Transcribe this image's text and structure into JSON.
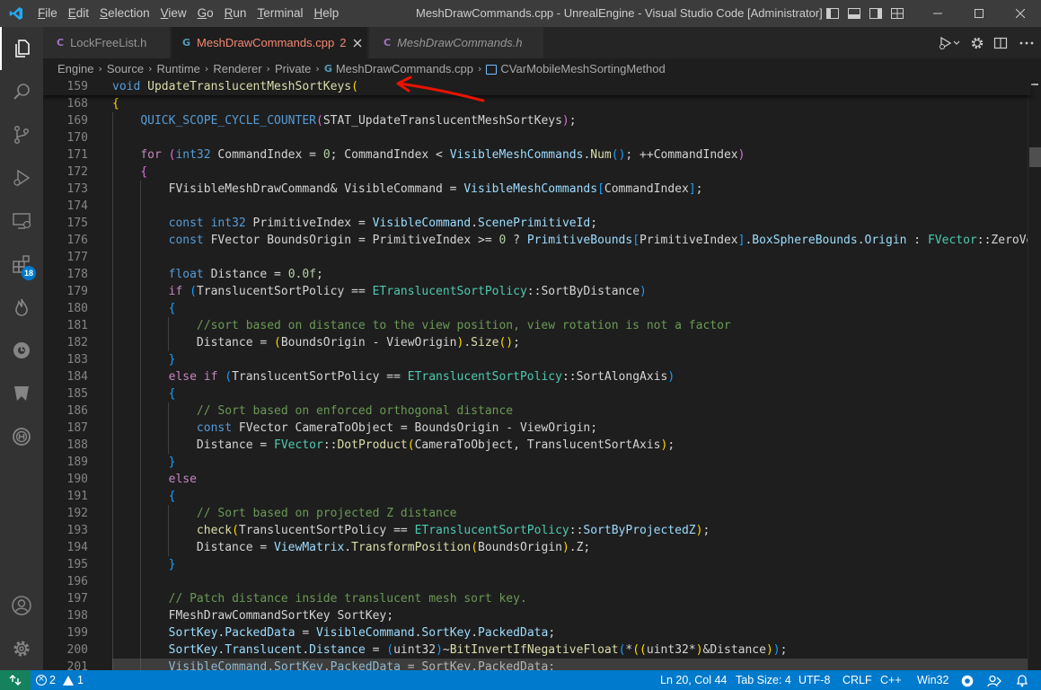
{
  "window": {
    "title": "MeshDrawCommands.cpp - UnrealEngine - Visual Studio Code [Administrator]",
    "menu": [
      "File",
      "Edit",
      "Selection",
      "View",
      "Go",
      "Run",
      "Terminal",
      "Help"
    ]
  },
  "tabs": [
    {
      "label": "LockFreeList.h",
      "icon": "C",
      "icon_color": "#a074c4",
      "color": "#969696",
      "italic": false
    },
    {
      "label": "MeshDrawCommands.cpp",
      "badge": "2",
      "icon": "G",
      "icon_color": "#519aba",
      "color": "#f48771",
      "italic": false
    },
    {
      "label": "MeshDrawCommands.h",
      "icon": "C",
      "icon_color": "#a074c4",
      "color": "#969696",
      "italic": true
    }
  ],
  "breadcrumbs": [
    "Engine",
    "Source",
    "Runtime",
    "Renderer",
    "Private",
    "MeshDrawCommands.cpp",
    "CVarMobileMeshSortingMethod"
  ],
  "activity_badge": "18",
  "status": {
    "errors": "2",
    "warnings": "1",
    "position": "Ln 20, Col 44",
    "tab_size": "Tab Size: 4",
    "encoding": "UTF-8",
    "eol": "CRLF",
    "language": "C++",
    "platform": "Win32"
  },
  "colors": {
    "accent": "#007acc",
    "remote": "#16825d",
    "error_tab": "#f48771",
    "arrow": "#e51400"
  },
  "editor": {
    "lines": [
      {
        "n": "159",
        "sticky": true,
        "tokens": [
          [
            "void ",
            "k"
          ],
          [
            "UpdateTranslucentMeshSortKeys",
            "f"
          ],
          [
            "(",
            "br1"
          ]
        ]
      },
      {
        "n": "168",
        "tokens": [
          [
            "{",
            "br1"
          ]
        ]
      },
      {
        "n": "169",
        "tokens": [
          [
            "    ",
            "p"
          ],
          [
            "QUICK_SCOPE_CYCLE_COUNTER",
            "mac"
          ],
          [
            "(",
            "br2"
          ],
          [
            "STAT_UpdateTranslucentMeshSortKeys",
            "p"
          ],
          [
            ")",
            "br2"
          ],
          [
            ";",
            "p"
          ]
        ]
      },
      {
        "n": "170",
        "tokens": []
      },
      {
        "n": "171",
        "tokens": [
          [
            "    ",
            "p"
          ],
          [
            "for",
            "c"
          ],
          [
            " ",
            "p"
          ],
          [
            "(",
            "br2"
          ],
          [
            "int32",
            "k"
          ],
          [
            " CommandIndex = ",
            "p"
          ],
          [
            "0",
            "n"
          ],
          [
            "; CommandIndex < ",
            "p"
          ],
          [
            "VisibleMeshCommands",
            "v"
          ],
          [
            ".",
            "p"
          ],
          [
            "Num",
            "f"
          ],
          [
            "()",
            "br3"
          ],
          [
            "; ++CommandIndex",
            "p"
          ],
          [
            ")",
            "br2"
          ]
        ]
      },
      {
        "n": "172",
        "tokens": [
          [
            "    ",
            "p"
          ],
          [
            "{",
            "br2"
          ]
        ]
      },
      {
        "n": "173",
        "tokens": [
          [
            "        FVisibleMeshDrawCommand& VisibleCommand = ",
            "p"
          ],
          [
            "VisibleMeshCommands",
            "v"
          ],
          [
            "[",
            "br3"
          ],
          [
            "CommandIndex",
            "p"
          ],
          [
            "]",
            "br3"
          ],
          [
            ";",
            "p"
          ]
        ]
      },
      {
        "n": "174",
        "tokens": []
      },
      {
        "n": "175",
        "tokens": [
          [
            "        ",
            "p"
          ],
          [
            "const",
            "k"
          ],
          [
            " ",
            "p"
          ],
          [
            "int32",
            "k"
          ],
          [
            " PrimitiveIndex = ",
            "p"
          ],
          [
            "VisibleCommand",
            "v"
          ],
          [
            ".",
            "p"
          ],
          [
            "ScenePrimitiveId",
            "v"
          ],
          [
            ";",
            "p"
          ]
        ]
      },
      {
        "n": "176",
        "tokens": [
          [
            "        ",
            "p"
          ],
          [
            "const",
            "k"
          ],
          [
            " FVector BoundsOrigin = PrimitiveIndex >= ",
            "p"
          ],
          [
            "0",
            "n"
          ],
          [
            " ? ",
            "p"
          ],
          [
            "PrimitiveBounds",
            "v"
          ],
          [
            "[",
            "br3"
          ],
          [
            "PrimitiveIndex",
            "p"
          ],
          [
            "]",
            "br3"
          ],
          [
            ".",
            "p"
          ],
          [
            "BoxSphereBounds",
            "v"
          ],
          [
            ".",
            "p"
          ],
          [
            "Origin",
            "v"
          ],
          [
            " : ",
            "p"
          ],
          [
            "FVector",
            "t"
          ],
          [
            "::ZeroVector;",
            "p"
          ]
        ]
      },
      {
        "n": "177",
        "tokens": []
      },
      {
        "n": "178",
        "tokens": [
          [
            "        ",
            "p"
          ],
          [
            "float",
            "k"
          ],
          [
            " Distance = ",
            "p"
          ],
          [
            "0.0f",
            "n"
          ],
          [
            ";",
            "p"
          ]
        ]
      },
      {
        "n": "179",
        "tokens": [
          [
            "        ",
            "p"
          ],
          [
            "if",
            "c"
          ],
          [
            " ",
            "p"
          ],
          [
            "(",
            "br3"
          ],
          [
            "TranslucentSortPolicy == ",
            "p"
          ],
          [
            "ETranslucentSortPolicy",
            "t"
          ],
          [
            "::SortByDistance",
            "p"
          ],
          [
            ")",
            "br3"
          ]
        ]
      },
      {
        "n": "180",
        "tokens": [
          [
            "        ",
            "p"
          ],
          [
            "{",
            "br3"
          ]
        ]
      },
      {
        "n": "181",
        "tokens": [
          [
            "            ",
            "p"
          ],
          [
            "//sort based on distance to the view position, view rotation is not a factor",
            "cm"
          ]
        ]
      },
      {
        "n": "182",
        "tokens": [
          [
            "            Distance = ",
            "p"
          ],
          [
            "(",
            "br1"
          ],
          [
            "BoundsOrigin - ViewOrigin",
            "p"
          ],
          [
            ")",
            "br1"
          ],
          [
            ".",
            "p"
          ],
          [
            "Size",
            "f"
          ],
          [
            "()",
            "br1"
          ],
          [
            ";",
            "p"
          ]
        ]
      },
      {
        "n": "183",
        "tokens": [
          [
            "        ",
            "p"
          ],
          [
            "}",
            "br3"
          ]
        ]
      },
      {
        "n": "184",
        "tokens": [
          [
            "        ",
            "p"
          ],
          [
            "else if",
            "c"
          ],
          [
            " ",
            "p"
          ],
          [
            "(",
            "br3"
          ],
          [
            "TranslucentSortPolicy == ",
            "p"
          ],
          [
            "ETranslucentSortPolicy",
            "t"
          ],
          [
            "::SortAlongAxis",
            "p"
          ],
          [
            ")",
            "br3"
          ]
        ]
      },
      {
        "n": "185",
        "tokens": [
          [
            "        ",
            "p"
          ],
          [
            "{",
            "br3"
          ]
        ]
      },
      {
        "n": "186",
        "tokens": [
          [
            "            ",
            "p"
          ],
          [
            "// Sort based on enforced orthogonal distance",
            "cm"
          ]
        ]
      },
      {
        "n": "187",
        "tokens": [
          [
            "            ",
            "p"
          ],
          [
            "const",
            "k"
          ],
          [
            " FVector CameraToObject = BoundsOrigin - ViewOrigin;",
            "p"
          ]
        ]
      },
      {
        "n": "188",
        "tokens": [
          [
            "            Distance = ",
            "p"
          ],
          [
            "FVector",
            "t"
          ],
          [
            "::",
            "p"
          ],
          [
            "DotProduct",
            "f"
          ],
          [
            "(",
            "br1"
          ],
          [
            "CameraToObject, TranslucentSortAxis",
            "p"
          ],
          [
            ")",
            "br1"
          ],
          [
            ";",
            "p"
          ]
        ]
      },
      {
        "n": "189",
        "tokens": [
          [
            "        ",
            "p"
          ],
          [
            "}",
            "br3"
          ]
        ]
      },
      {
        "n": "190",
        "tokens": [
          [
            "        ",
            "p"
          ],
          [
            "else",
            "c"
          ]
        ]
      },
      {
        "n": "191",
        "tokens": [
          [
            "        ",
            "p"
          ],
          [
            "{",
            "br3"
          ]
        ]
      },
      {
        "n": "192",
        "tokens": [
          [
            "            ",
            "p"
          ],
          [
            "// Sort based on projected Z distance",
            "cm"
          ]
        ]
      },
      {
        "n": "193",
        "tokens": [
          [
            "            ",
            "p"
          ],
          [
            "check",
            "f"
          ],
          [
            "(",
            "br1"
          ],
          [
            "TranslucentSortPolicy == ",
            "p"
          ],
          [
            "ETranslucentSortPolicy",
            "t"
          ],
          [
            "::",
            "p"
          ],
          [
            "SortByProjectedZ",
            "v"
          ],
          [
            ")",
            "br1"
          ],
          [
            ";",
            "p"
          ]
        ]
      },
      {
        "n": "194",
        "tokens": [
          [
            "            Distance = ",
            "p"
          ],
          [
            "ViewMatrix",
            "v"
          ],
          [
            ".",
            "p"
          ],
          [
            "TransformPosition",
            "f"
          ],
          [
            "(",
            "br1"
          ],
          [
            "BoundsOrigin",
            "p"
          ],
          [
            ")",
            "br1"
          ],
          [
            ".Z;",
            "p"
          ]
        ]
      },
      {
        "n": "195",
        "tokens": [
          [
            "        ",
            "p"
          ],
          [
            "}",
            "br3"
          ]
        ]
      },
      {
        "n": "196",
        "tokens": []
      },
      {
        "n": "197",
        "tokens": [
          [
            "        ",
            "p"
          ],
          [
            "// Patch distance inside translucent mesh sort key.",
            "cm"
          ]
        ]
      },
      {
        "n": "198",
        "tokens": [
          [
            "        FMeshDrawCommandSortKey SortKey;",
            "p"
          ]
        ]
      },
      {
        "n": "199",
        "tokens": [
          [
            "        ",
            "p"
          ],
          [
            "SortKey",
            "v"
          ],
          [
            ".",
            "p"
          ],
          [
            "PackedData",
            "v"
          ],
          [
            " = ",
            "p"
          ],
          [
            "VisibleCommand",
            "v"
          ],
          [
            ".",
            "p"
          ],
          [
            "SortKey",
            "v"
          ],
          [
            ".",
            "p"
          ],
          [
            "PackedData",
            "v"
          ],
          [
            ";",
            "p"
          ]
        ]
      },
      {
        "n": "200",
        "tokens": [
          [
            "        ",
            "p"
          ],
          [
            "SortKey",
            "v"
          ],
          [
            ".",
            "p"
          ],
          [
            "Translucent",
            "v"
          ],
          [
            ".",
            "p"
          ],
          [
            "Distance",
            "v"
          ],
          [
            " = ",
            "p"
          ],
          [
            "(",
            "br3"
          ],
          [
            "uint32",
            "p"
          ],
          [
            ")",
            "br3"
          ],
          [
            "~",
            "p"
          ],
          [
            "BitInvertIfNegativeFloat",
            "f"
          ],
          [
            "(",
            "br3"
          ],
          [
            "*",
            "p"
          ],
          [
            "((",
            "br1"
          ],
          [
            "uint32",
            "p"
          ],
          [
            "*",
            "p"
          ],
          [
            ")",
            "br1"
          ],
          [
            "&Distance",
            "p"
          ],
          [
            ")",
            "br1"
          ],
          [
            ")",
            "br3"
          ],
          [
            ";",
            "p"
          ]
        ]
      },
      {
        "n": "201",
        "tokens": [
          [
            "        ",
            "p"
          ],
          [
            "VisibleCommand",
            "v"
          ],
          [
            ".",
            "p"
          ],
          [
            "SortKey",
            "v"
          ],
          [
            ".",
            "p"
          ],
          [
            "PackedData",
            "v"
          ],
          [
            " = SortKey.PackedData;",
            "p"
          ]
        ]
      }
    ]
  }
}
